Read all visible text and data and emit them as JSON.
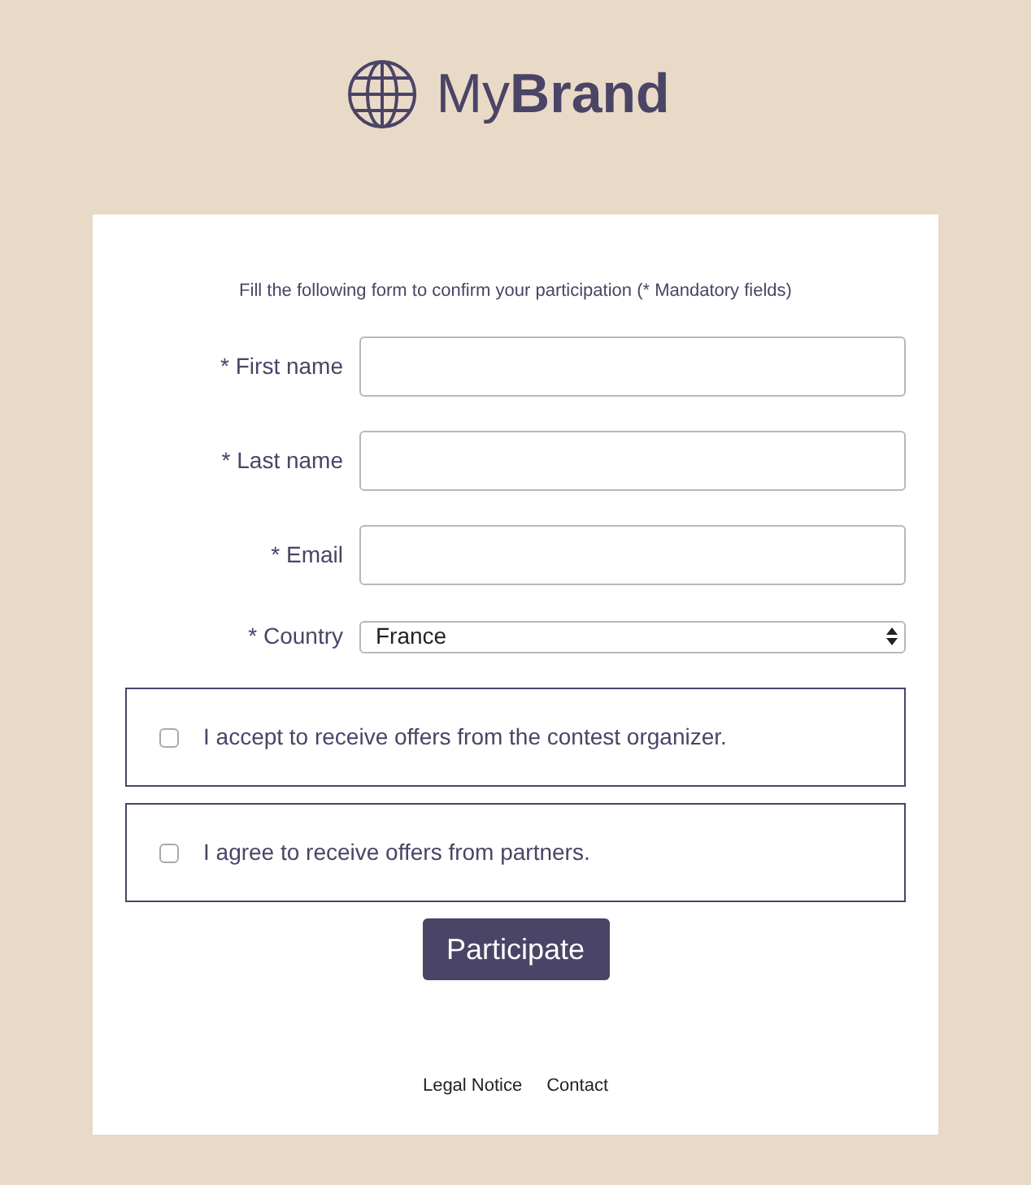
{
  "brand": {
    "name": "My**Brand**"
  },
  "form": {
    "intro": "Fill the following form to confirm your participation (* Mandatory fields)",
    "fields": [
      {
        "kind": "text",
        "label": "* First name"
      },
      {
        "kind": "text",
        "label": "* Last name"
      },
      {
        "kind": "text",
        "label": "* Email"
      },
      {
        "kind": "select",
        "label": "* Country",
        "value": "France"
      }
    ],
    "consents": [
      {
        "label": "I accept to receive offers from the contest organizer.",
        "checked": false
      },
      {
        "label": "I agree to receive offers from partners.",
        "checked": false
      }
    ],
    "submit": "Participate"
  },
  "footer_links": [
    "Legal Notice",
    "Contact"
  ]
}
